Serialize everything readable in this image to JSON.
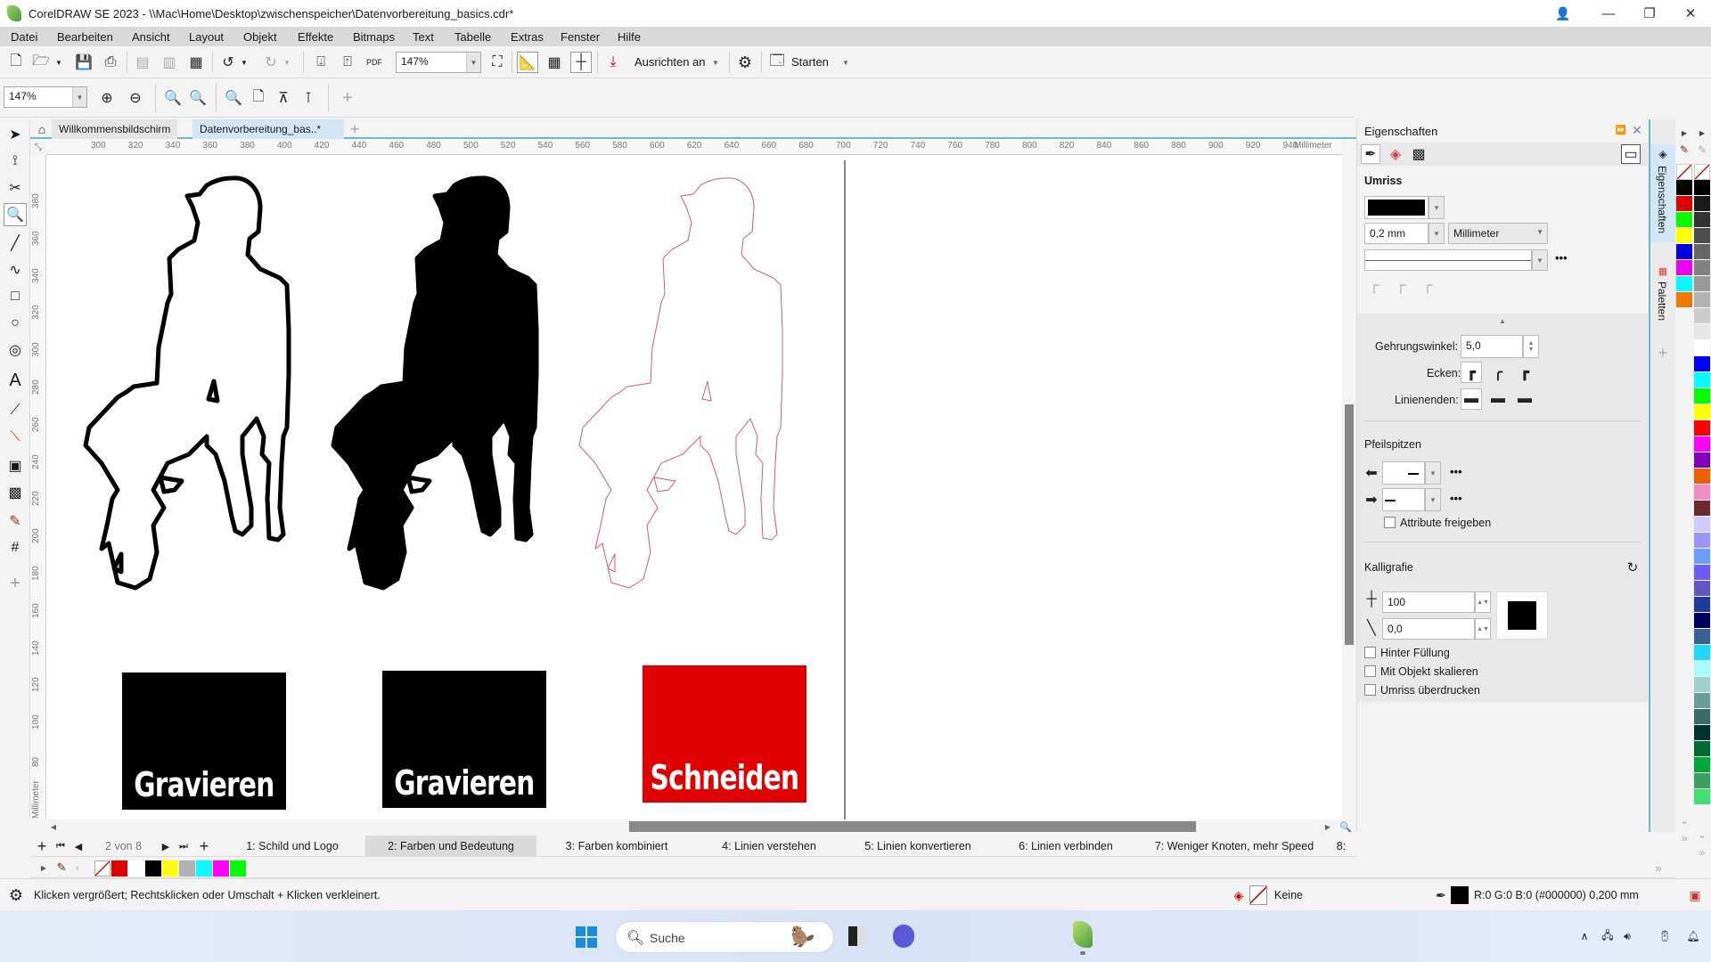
{
  "window": {
    "title": "CorelDRAW SE 2023 - \\\\Mac\\Home\\Desktop\\zwischenspeicher\\Datenvorbereitung_basics.cdr*",
    "controls": {
      "minimize": "—",
      "restore": "❐",
      "close": "✕"
    }
  },
  "menu": [
    "Datei",
    "Bearbeiten",
    "Ansicht",
    "Layout",
    "Objekt",
    "Effekte",
    "Bitmaps",
    "Text",
    "Tabelle",
    "Extras",
    "Fenster",
    "Hilfe"
  ],
  "toolbar": {
    "zoom_value": "147%",
    "snap_label": "Ausrichten an",
    "launch_label": "Starten",
    "pdf_label": "PDF"
  },
  "zoombar": {
    "zoom_value": "147%"
  },
  "doc_tabs": [
    {
      "label": "Willkommensbildschirm",
      "active": false
    },
    {
      "label": "Datenvorbereitung_bas..*",
      "active": true
    }
  ],
  "ruler": {
    "unit": "Millimeter",
    "top_ticks": [
      "300",
      "320",
      "340",
      "360",
      "380",
      "400",
      "420",
      "440",
      "460",
      "480",
      "500",
      "520",
      "540",
      "560",
      "580",
      "600",
      "620",
      "640",
      "660",
      "680",
      "700",
      "720",
      "740",
      "760",
      "780",
      "800",
      "820",
      "840",
      "860",
      "880",
      "900",
      "920",
      "940"
    ],
    "left_ticks": [
      "380",
      "360",
      "340",
      "320",
      "300",
      "280",
      "260",
      "240",
      "220",
      "200",
      "180",
      "160",
      "140",
      "120",
      "100",
      "80"
    ],
    "left_unit": "Millimeter"
  },
  "canvas": {
    "figures": [
      {
        "name": "worker-outline-thick",
        "style": "outline-black"
      },
      {
        "name": "worker-filled",
        "style": "fill-black"
      },
      {
        "name": "worker-outline-hairline",
        "style": "outline-red"
      }
    ],
    "labels": [
      {
        "text": "Gravieren",
        "bg": "#000000"
      },
      {
        "text": "Gravieren",
        "bg": "#000000"
      },
      {
        "text": "Schneiden",
        "bg": "#e00000"
      }
    ]
  },
  "page_nav": {
    "current": "2",
    "of_label": "von",
    "total": "8"
  },
  "page_tabs": [
    {
      "label": "1: Schild und Logo",
      "active": false
    },
    {
      "label": "2: Farben und Bedeutung",
      "active": true
    },
    {
      "label": "3: Farben kombiniert",
      "active": false
    },
    {
      "label": "4: Linien verstehen",
      "active": false
    },
    {
      "label": "5: Linien konvertieren",
      "active": false
    },
    {
      "label": "6: Linien verbinden",
      "active": false
    },
    {
      "label": "7: Weniger Knoten, mehr Speed",
      "active": false
    },
    {
      "label": "8:",
      "active": false
    }
  ],
  "doc_palette": [
    "none",
    "#e00000",
    "#ffffff",
    "#000000",
    "#ffff00",
    "#b0b0b0",
    "#00ffff",
    "#ff00ff",
    "#00ff00"
  ],
  "status": {
    "hint": "Klicken vergrößert; Rechtsklicken oder Umschalt + Klicken verkleinert.",
    "fill_label": "Keine",
    "outline_info": "R:0 G:0 B:0 (#000000)  0,200 mm"
  },
  "properties": {
    "title": "Eigenschaften",
    "section_outline": "Umriss",
    "outline_color": "#000000",
    "width_value": "0,2 mm",
    "unit_value": "Millimeter",
    "miter_label": "Gehrungswinkel:",
    "miter_value": "5,0",
    "corners_label": "Ecken:",
    "line_ends_label": "Linienenden:",
    "arrowheads_title": "Pfeilspitzen",
    "share_attributes": "Attribute freigeben",
    "calligraphy_title": "Kalligrafie",
    "stretch_value": "100",
    "angle_value": "0,0",
    "behind_fill": "Hinter Füllung",
    "scale_with_object": "Mit Objekt skalieren",
    "overprint_outline": "Umriss überdrucken",
    "more": "•••"
  },
  "docker_tabs": [
    "Eigenschaften",
    "Paletten"
  ],
  "palette_main": [
    "#000000",
    "#e00000",
    "#00ff00",
    "#ffff00",
    "#0000ee",
    "#ee00ee",
    "#00ffff",
    "#f07800"
  ],
  "palette_default": [
    "#000000",
    "#1a1a1a",
    "#333333",
    "#4d4d4d",
    "#666666",
    "#808080",
    "#999999",
    "#b3b3b3",
    "#cccccc",
    "#e6e6e6",
    "#ffffff",
    "#0000ff",
    "#00ffff",
    "#00ff00",
    "#ffff00",
    "#ff0000",
    "#ff00ff",
    "#8000c0",
    "#f06000",
    "#f08cc8",
    "#6b2a2a",
    "#d0ccff",
    "#9c94f8",
    "#6c9cff",
    "#6a5cff",
    "#6058c8",
    "#1e3aa0",
    "#000060",
    "#3a6098",
    "#20d8ff",
    "#a8fcfc",
    "#a0d0cc",
    "#6a9c98",
    "#3a6a64",
    "#003030",
    "#006a30",
    "#00a83a",
    "#3aa060",
    "#40e070"
  ],
  "taskbar": {
    "search_placeholder": "Suche"
  }
}
